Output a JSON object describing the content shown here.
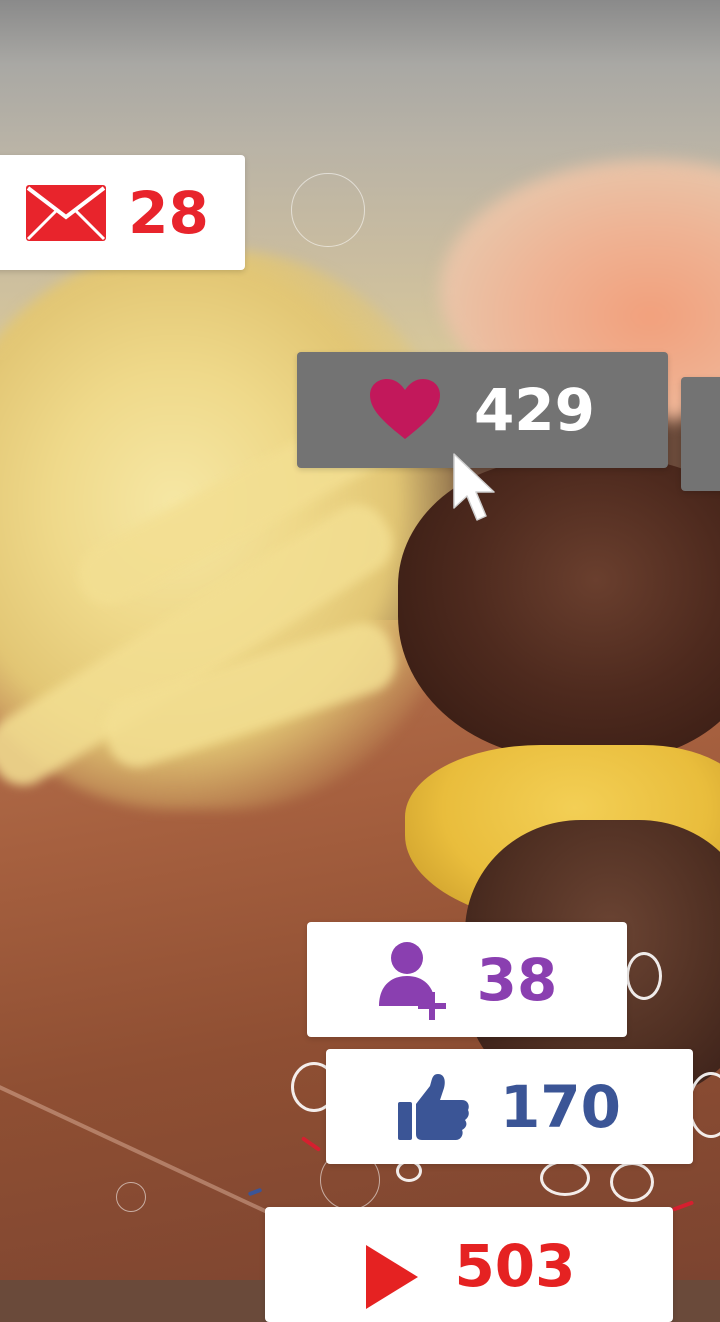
{
  "notifications": {
    "mail": {
      "icon": "envelope-icon",
      "count": "28",
      "color": "#e8242c"
    },
    "hearts": {
      "icon": "heart-icon",
      "count": "429",
      "color": "#c2185b"
    },
    "followers": {
      "icon": "add-user-icon",
      "count": "38",
      "color": "#8a3fb0"
    },
    "likes": {
      "icon": "thumbs-up-icon",
      "count": "170",
      "color": "#3b5596"
    },
    "views": {
      "icon": "play-icon",
      "count": "503",
      "color": "#e52222"
    }
  },
  "cursor": {
    "icon": "mouse-pointer-icon"
  }
}
